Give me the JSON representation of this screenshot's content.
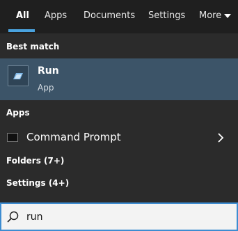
{
  "tabs": [
    {
      "label": "All",
      "active": true
    },
    {
      "label": "Apps"
    },
    {
      "label": "Documents"
    },
    {
      "label": "Settings"
    },
    {
      "label": "More"
    }
  ],
  "best_match": {
    "header": "Best match",
    "item": {
      "title": "Run",
      "subtitle": "App",
      "icon": "run-icon"
    }
  },
  "apps": {
    "header": "Apps",
    "items": [
      {
        "label": "Command Prompt",
        "icon": "command-prompt-icon"
      }
    ]
  },
  "categories": [
    {
      "label": "Folders (7+)"
    },
    {
      "label": "Settings (4+)"
    }
  ],
  "search": {
    "value": "run"
  },
  "colors": {
    "accent": "#3d8cd1",
    "selected_row": "#3c5468",
    "panel": "#2b2b2b",
    "tab_bar": "#1f1f1f"
  }
}
